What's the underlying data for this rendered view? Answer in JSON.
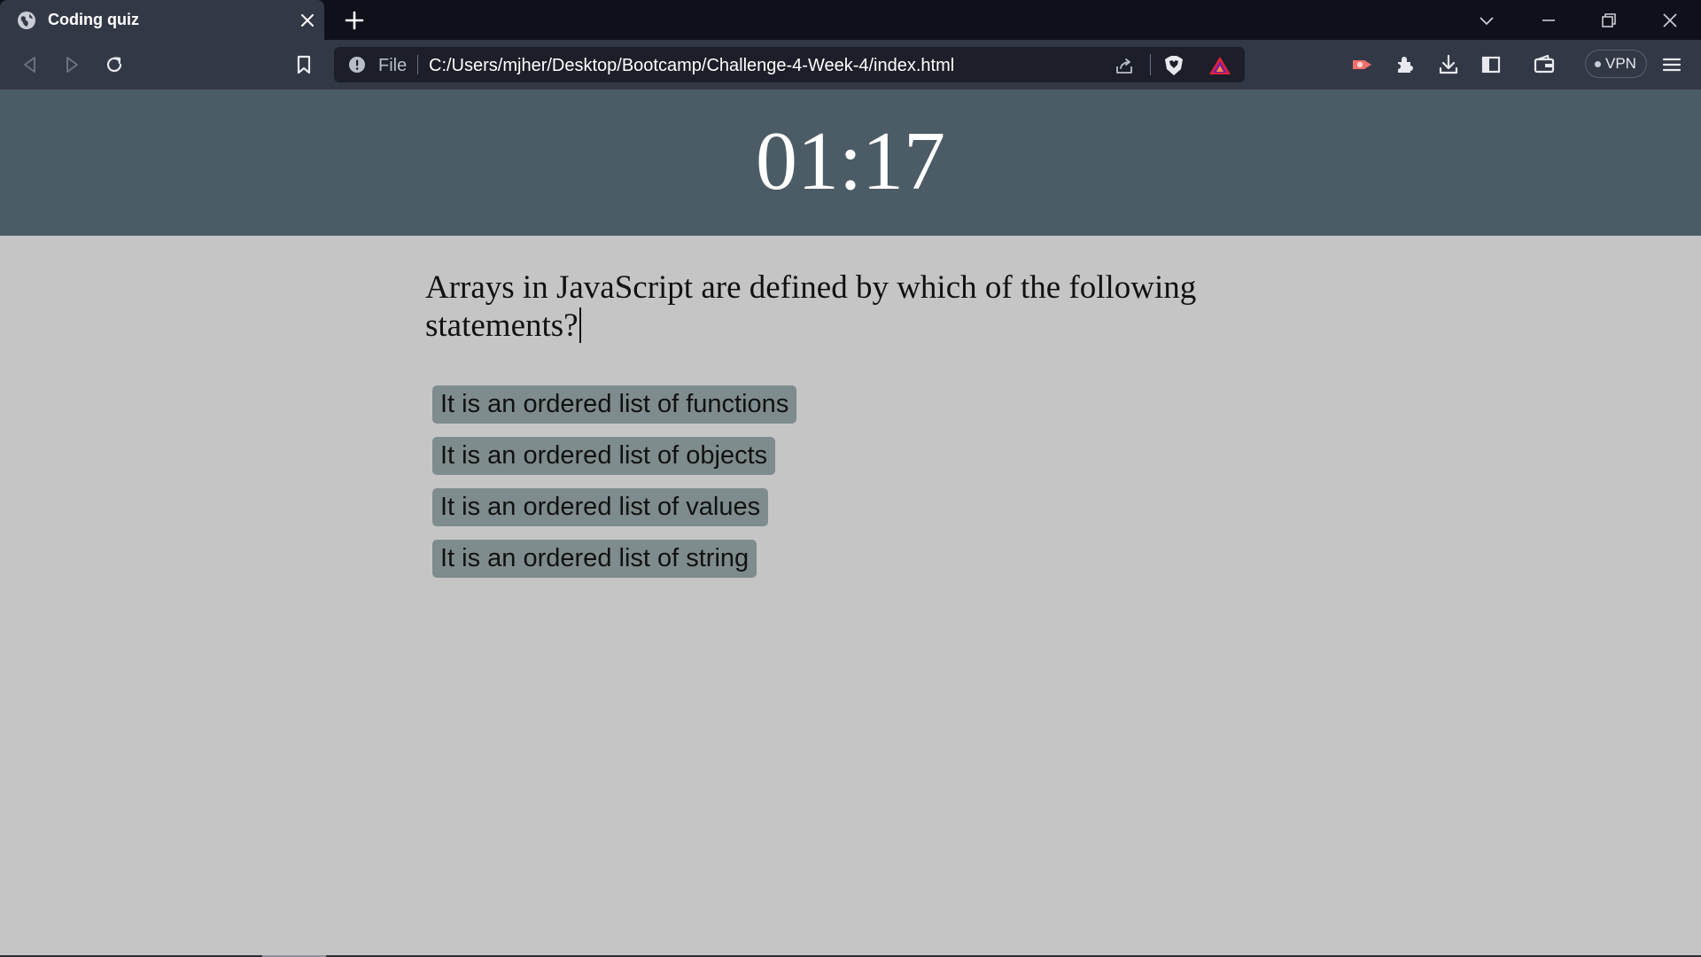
{
  "browser": {
    "tab": {
      "title": "Coding quiz",
      "favicon": "globe-icon"
    },
    "address_bar": {
      "scheme_label": "File",
      "url": "C:/Users/mjher/Desktop/Bootcamp/Challenge-4-Week-4/index.html"
    },
    "vpn_label": "VPN",
    "icons": [
      "back-icon",
      "forward-icon",
      "reload-icon",
      "bookmark-icon",
      "info-icon",
      "share-icon",
      "brave-shield-icon",
      "brave-rewards-icon",
      "leo-icon",
      "extensions-icon",
      "download-icon",
      "sidebar-icon",
      "wallet-icon",
      "menu-icon",
      "tab-search-icon",
      "minimize-icon",
      "restore-icon",
      "close-icon"
    ],
    "colors": {
      "tab_strip": "#0f111a",
      "toolbar": "#333846",
      "url_field": "#1c1f29"
    }
  },
  "quiz": {
    "timer": "01:17",
    "question": "Arrays in JavaScript are defined by which of the following statements?",
    "answers": [
      "It is an ordered list of functions",
      "It is an ordered list of objects",
      "It is an ordered list of values",
      "It is an ordered list of string"
    ],
    "colors": {
      "header": "#4c5c66",
      "background": "#c5c5c5",
      "answer_button": "#7f8c8d"
    }
  }
}
